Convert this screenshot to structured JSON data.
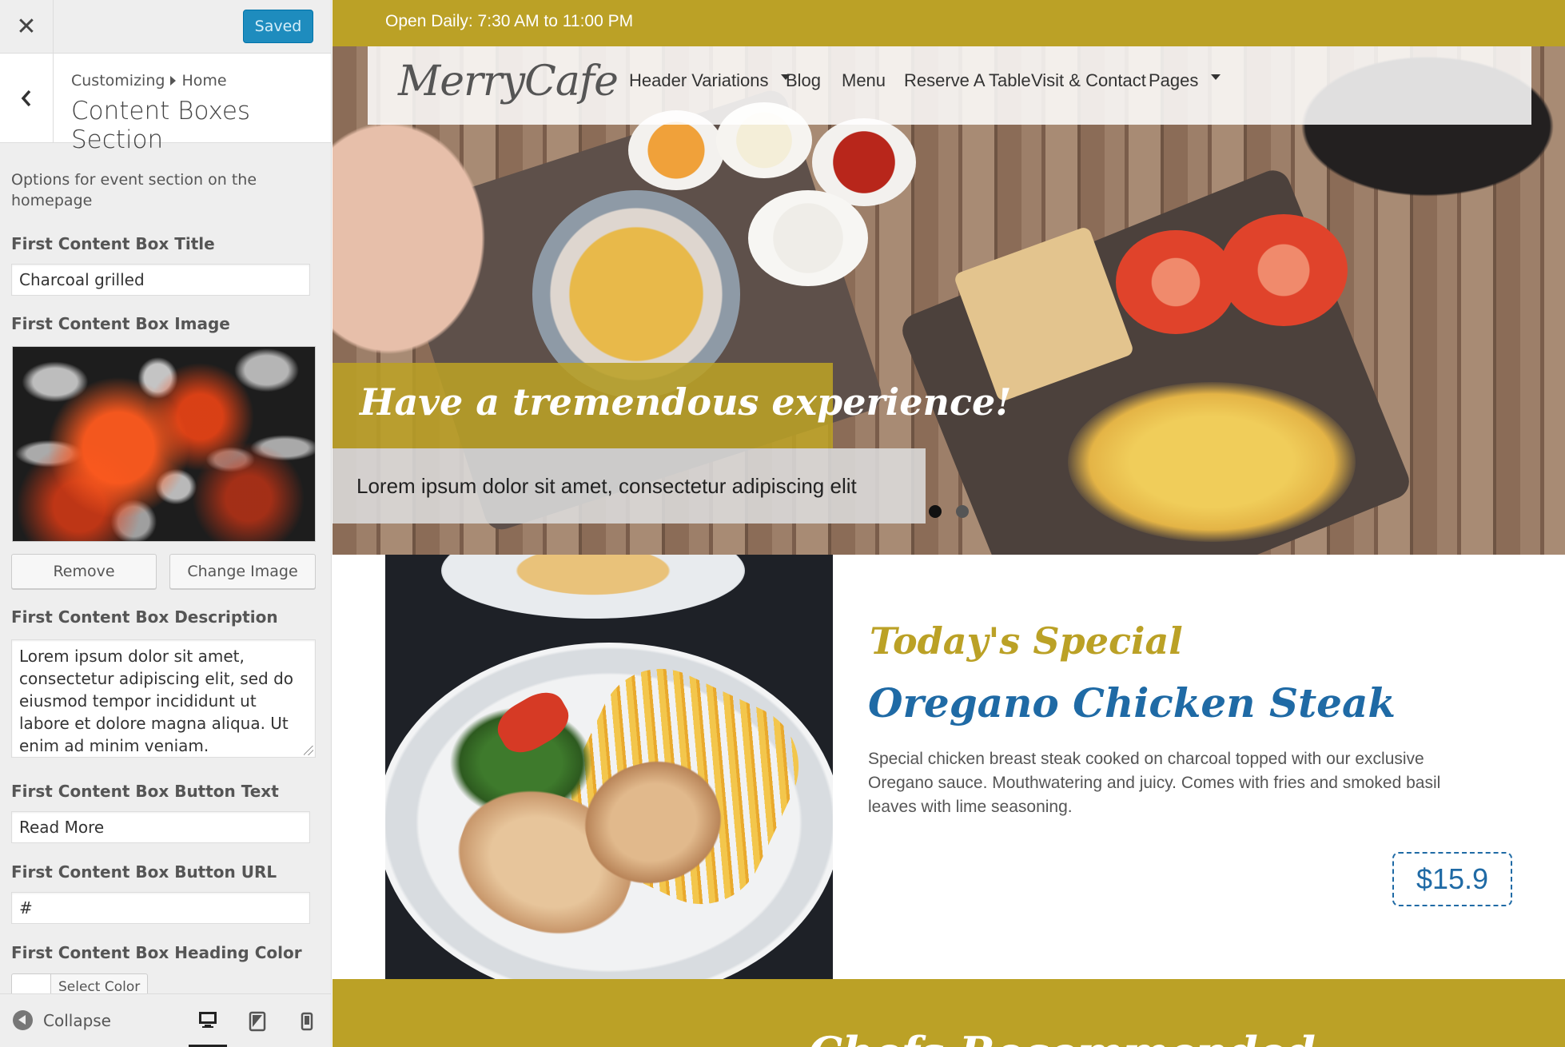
{
  "customizer": {
    "saved_label": "Saved",
    "breadcrumb": {
      "root": "Customizing",
      "current": "Home"
    },
    "section_title": "Content Boxes Section",
    "description": "Options for event section on the homepage",
    "fields": {
      "title_label": "First Content Box Title",
      "title_value": "Charcoal grilled",
      "image_label": "First Content Box Image",
      "remove_label": "Remove",
      "change_image_label": "Change Image",
      "description_label": "First Content Box Description",
      "description_value": "Lorem ipsum dolor sit amet, consectetur adipiscing elit, sed do eiusmod tempor incididunt ut labore et dolore magna aliqua. Ut enim ad minim veniam.",
      "button_text_label": "First Content Box Button Text",
      "button_text_value": "Read More",
      "button_url_label": "First Content Box Button URL",
      "button_url_value": "#",
      "heading_color_label": "First Content Box Heading Color",
      "select_color_label": "Select Color"
    },
    "footer": {
      "collapse_label": "Collapse"
    }
  },
  "site": {
    "open_hours": "Open Daily: 7:30 AM to 11:00 PM",
    "logo": "MerryCafe",
    "nav": [
      {
        "label": "Header Variations"
      },
      {
        "label": "Blog"
      },
      {
        "label": "Menu"
      },
      {
        "label": "Reserve A Table"
      },
      {
        "label": "Visit & Contact"
      },
      {
        "label": "Pages"
      }
    ],
    "hero": {
      "title": "Have a tremendous experience!",
      "subtitle": "Lorem ipsum dolor sit amet, consectetur adipiscing elit"
    },
    "special": {
      "kicker": "Today's Special",
      "dish": "Oregano Chicken Steak",
      "description": "Special chicken breast steak cooked on charcoal topped with our exclusive Oregano sauce. Mouthwatering and juicy. Comes with fries and smoked basil leaves with lime seasoning.",
      "price": "$15.9"
    },
    "bottom_heading": "Chefs Recommended"
  },
  "colors": {
    "accent_gold": "#bba126",
    "accent_blue": "#1f6aa5",
    "wp_blue": "#1e8cbe",
    "sidebar_bg": "#eeeeee"
  },
  "icons": [
    "close-icon",
    "back-chevron-icon",
    "collapse-icon",
    "desktop-icon",
    "tablet-icon",
    "mobile-icon",
    "dropdown-caret-icon"
  ]
}
